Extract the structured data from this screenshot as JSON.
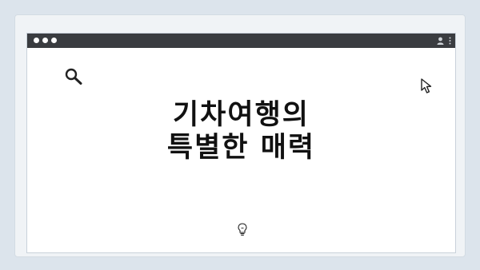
{
  "window": {
    "traffic_lights": [
      "dot",
      "dot",
      "dot"
    ],
    "icons": [
      "user-icon",
      "more-vertical-icon"
    ]
  },
  "content": {
    "title_line1": "기차여행의",
    "title_line2": "특별한 매력",
    "icons": [
      "search-icon",
      "cursor-arrow-icon",
      "lightbulb-icon"
    ]
  },
  "colors": {
    "background": "#dce4ec",
    "titlebar": "#3a3c40",
    "text": "#111111"
  }
}
